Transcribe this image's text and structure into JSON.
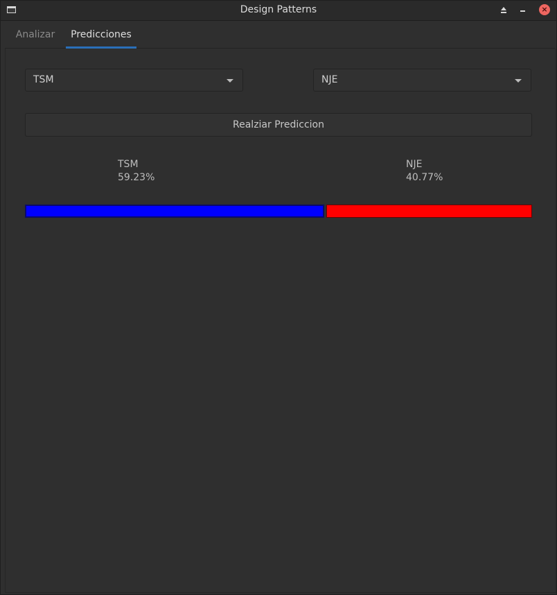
{
  "window": {
    "title": "Design Patterns"
  },
  "tabs": [
    {
      "label": "Analizar",
      "active": false
    },
    {
      "label": "Predicciones",
      "active": true
    }
  ],
  "team_a_select": {
    "value": "TSM"
  },
  "team_b_select": {
    "value": "NJE"
  },
  "predict_button": {
    "label": "Realziar Prediccion"
  },
  "result": {
    "team_a": {
      "name": "TSM",
      "percent_text": "59.23%",
      "fraction": 0.5923,
      "color": "#0000ff"
    },
    "team_b": {
      "name": "NJE",
      "percent_text": "40.77%",
      "fraction": 0.4077,
      "color": "#ff0000"
    }
  },
  "icons": {
    "app": "window-icon",
    "eject": "eject-icon",
    "minimize": "minimize-icon",
    "close": "close-icon",
    "dropdown": "chevron-down-icon"
  }
}
